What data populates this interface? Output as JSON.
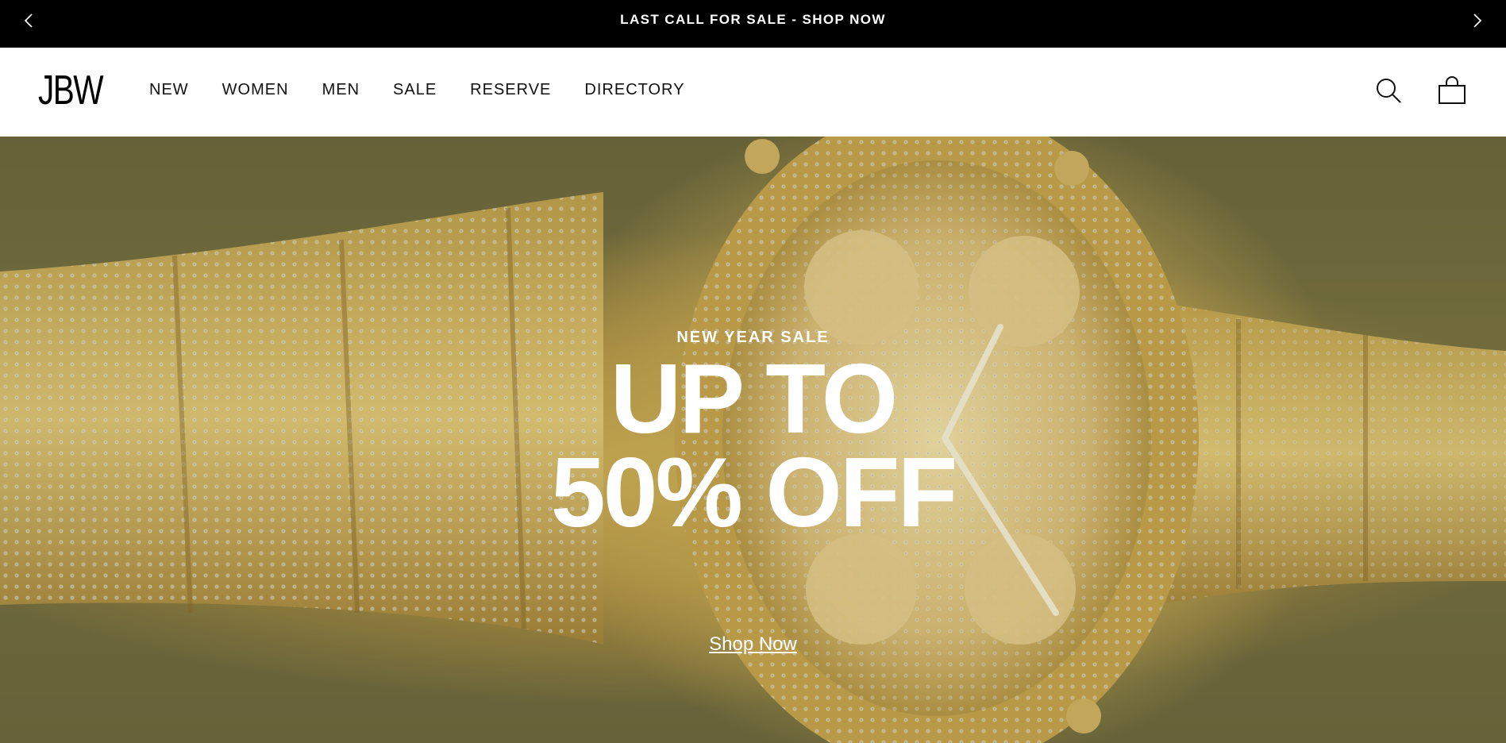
{
  "announcement": {
    "text": "LAST CALL FOR SALE - SHOP NOW",
    "prev_icon": "chevron-left-icon",
    "next_icon": "chevron-right-icon"
  },
  "header": {
    "logo": "JBW",
    "nav": [
      {
        "label": "NEW"
      },
      {
        "label": "WOMEN"
      },
      {
        "label": "MEN"
      },
      {
        "label": "SALE"
      },
      {
        "label": "RESERVE"
      },
      {
        "label": "DIRECTORY"
      }
    ],
    "icons": [
      "search-icon",
      "shopping-bag-icon"
    ]
  },
  "hero": {
    "eyebrow": "NEW YEAR SALE",
    "headline_line1": "UP TO",
    "headline_line2": "50% OFF",
    "cta": "Shop Now"
  },
  "colors": {
    "announcement_bg": "#000000",
    "hero_text": "#ffffff",
    "gold": "#d4b35a"
  }
}
